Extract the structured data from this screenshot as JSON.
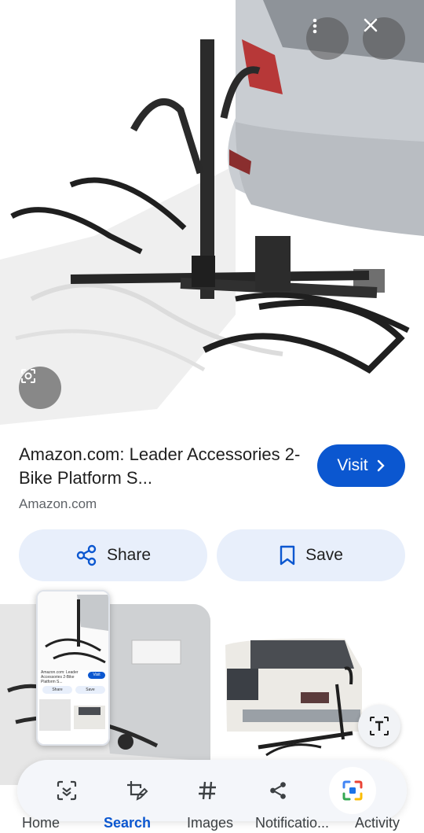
{
  "result": {
    "title": "Amazon.com: Leader Accessories 2-Bike Platform S...",
    "source": "Amazon.com",
    "visit_label": "Visit",
    "share_label": "Share",
    "save_label": "Save"
  },
  "mini_preview": {
    "title": "Amazon.com: Leader Accessories 2-Bike Platform S...",
    "share": "Share",
    "save": "Save",
    "visit": "Visit"
  },
  "nav": {
    "home": "Home",
    "search": "Search",
    "images": "Images",
    "notifications": "Notificatio...",
    "activity": "Activity"
  },
  "colors": {
    "accent": "#0b57d0",
    "pill_bg": "#e8effb",
    "text": "#1f1f1f",
    "muted": "#5f6368"
  },
  "icons": [
    "more-vert-icon",
    "close-icon",
    "lens-icon",
    "chevron-right-icon",
    "share-icon",
    "bookmark-icon",
    "text-select-icon",
    "scan-icon",
    "crop-edit-icon",
    "hashtag-icon",
    "share-icon",
    "screen-search-icon"
  ]
}
